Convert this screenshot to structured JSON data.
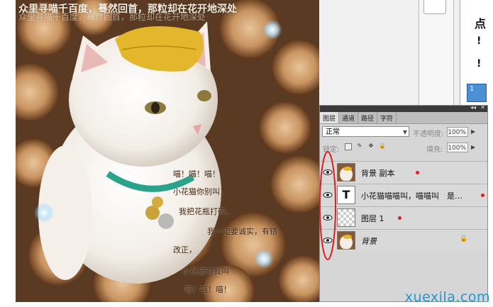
{
  "photo": {
    "caption_top": "众里寻喵千百度，蓦然回首，那粒却在花开地深处",
    "caption_top_echo": "众里寻喵千百度，蓦然回首，那粒却在花开地深处",
    "poem_lines": [
      "喵！喵！喵！",
      "小花猫你别叫，",
      "我把花瓶打碎，",
      "我一定要诚实，有错",
      "改正，",
      "小花猫对我叫",
      "喵！喵！喵！"
    ]
  },
  "side_window": {
    "char_1": "点",
    "char_2": "!",
    "char_3": "!",
    "char_4": "1"
  },
  "layers_panel": {
    "tabs": [
      "图层",
      "通道",
      "路径",
      "字符"
    ],
    "collapse_glyph": "◂◂",
    "close_glyph": "✕",
    "blend_mode": "正常",
    "opacity_label": "不透明度:",
    "opacity_value": "100%",
    "lock_label": "锁定:",
    "fill_label": "填充:",
    "fill_value": "100%",
    "layers": [
      {
        "name": "背景 副本",
        "kind": "image"
      },
      {
        "name": "小花猫喵喵叫，喵喵叫　是…",
        "kind": "text",
        "thumb_glyph": "T"
      },
      {
        "name": "图层 1",
        "kind": "transparent"
      },
      {
        "name": "背景",
        "kind": "image",
        "locked": true
      }
    ]
  },
  "watermark": "xuexila.com",
  "colors": {
    "annotation_red": "#e01e1e",
    "watermark_blue": "#1a9bd7",
    "panel_bg": "#d6d6d6"
  }
}
